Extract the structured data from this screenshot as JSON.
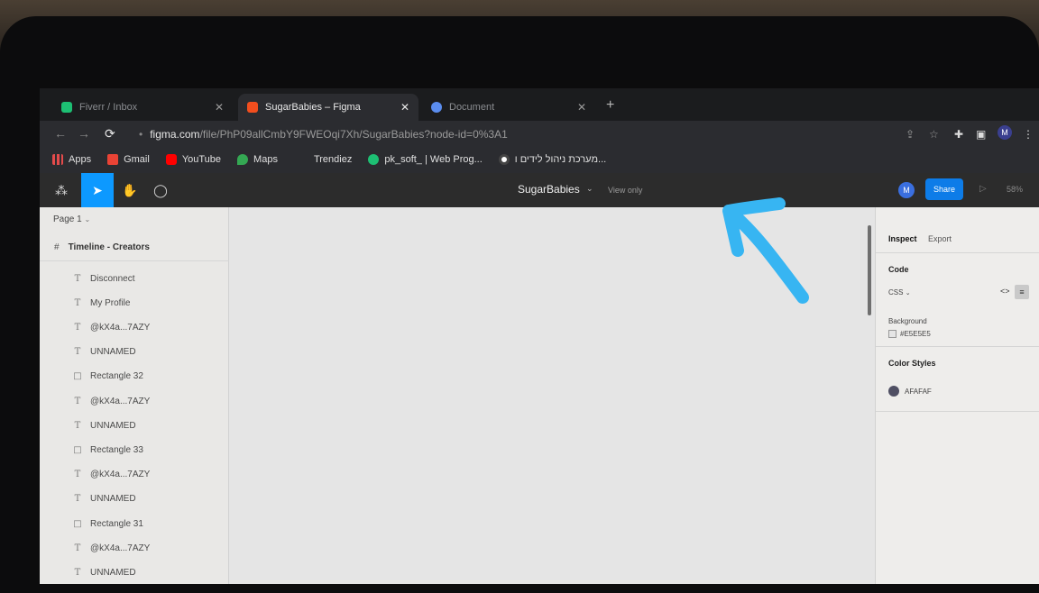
{
  "browser": {
    "tabs": [
      {
        "label": "Fiverr / Inbox",
        "favicon_color": "#1dbf73"
      },
      {
        "label": "SugarBabies – Figma",
        "favicon_color": "#f24e1e"
      },
      {
        "label": "Document",
        "favicon_color": "#5b8def"
      }
    ],
    "url_host": "figma.com",
    "url_path": "/file/PhP09allCmbY9FWEOqi7Xh/SugarBabies?node-id=0%3A1",
    "bookmarks": [
      {
        "label": "Apps",
        "icon": "apps-grid-icon",
        "color": "#e34b4b"
      },
      {
        "label": "Gmail",
        "icon": "gmail-icon",
        "color": "#ea4335"
      },
      {
        "label": "YouTube",
        "icon": "youtube-icon",
        "color": "#ff0000"
      },
      {
        "label": "Maps",
        "icon": "maps-icon",
        "color": "#34a853"
      },
      {
        "label": "Trendiez",
        "icon": "",
        "color": ""
      },
      {
        "label": "pk_soft_ | Web Prog...",
        "icon": "fiverr-icon",
        "color": "#1dbf73"
      },
      {
        "label": "מערכת ניהול לידים ו...",
        "icon": "circle-icon",
        "color": "#ffffff"
      }
    ],
    "profile_initial": "M"
  },
  "figma": {
    "doc_title": "SugarBabies",
    "view_mode": "View only",
    "user_initial": "M",
    "share_label": "Share",
    "zoom": "58%",
    "accent": "#0d99ff"
  },
  "layers": {
    "page": "Page 1",
    "frame": "Timeline - Creators",
    "items": [
      {
        "type": "text",
        "label": "Disconnect"
      },
      {
        "type": "text",
        "label": "My Profile"
      },
      {
        "type": "text",
        "label": "@kX4a...7AZY"
      },
      {
        "type": "text",
        "label": "UNNAMED"
      },
      {
        "type": "rect",
        "label": "Rectangle 32"
      },
      {
        "type": "text",
        "label": "@kX4a...7AZY"
      },
      {
        "type": "text",
        "label": "UNNAMED"
      },
      {
        "type": "rect",
        "label": "Rectangle 33"
      },
      {
        "type": "text",
        "label": "@kX4a...7AZY"
      },
      {
        "type": "text",
        "label": "UNNAMED"
      },
      {
        "type": "rect",
        "label": "Rectangle 31"
      },
      {
        "type": "text",
        "label": "@kX4a...7AZY"
      },
      {
        "type": "text",
        "label": "UNNAMED"
      }
    ]
  },
  "inspect": {
    "tabs": [
      "Inspect",
      "Export"
    ],
    "code_heading": "Code",
    "code_lang": "CSS",
    "background_heading": "Background",
    "background_value": "#E5E5E5",
    "color_styles_heading": "Color Styles",
    "color_style_value": "AFAFAF",
    "color_style_swatch": "#4f4f63"
  },
  "annotation": {
    "color": "#37b5f2"
  }
}
